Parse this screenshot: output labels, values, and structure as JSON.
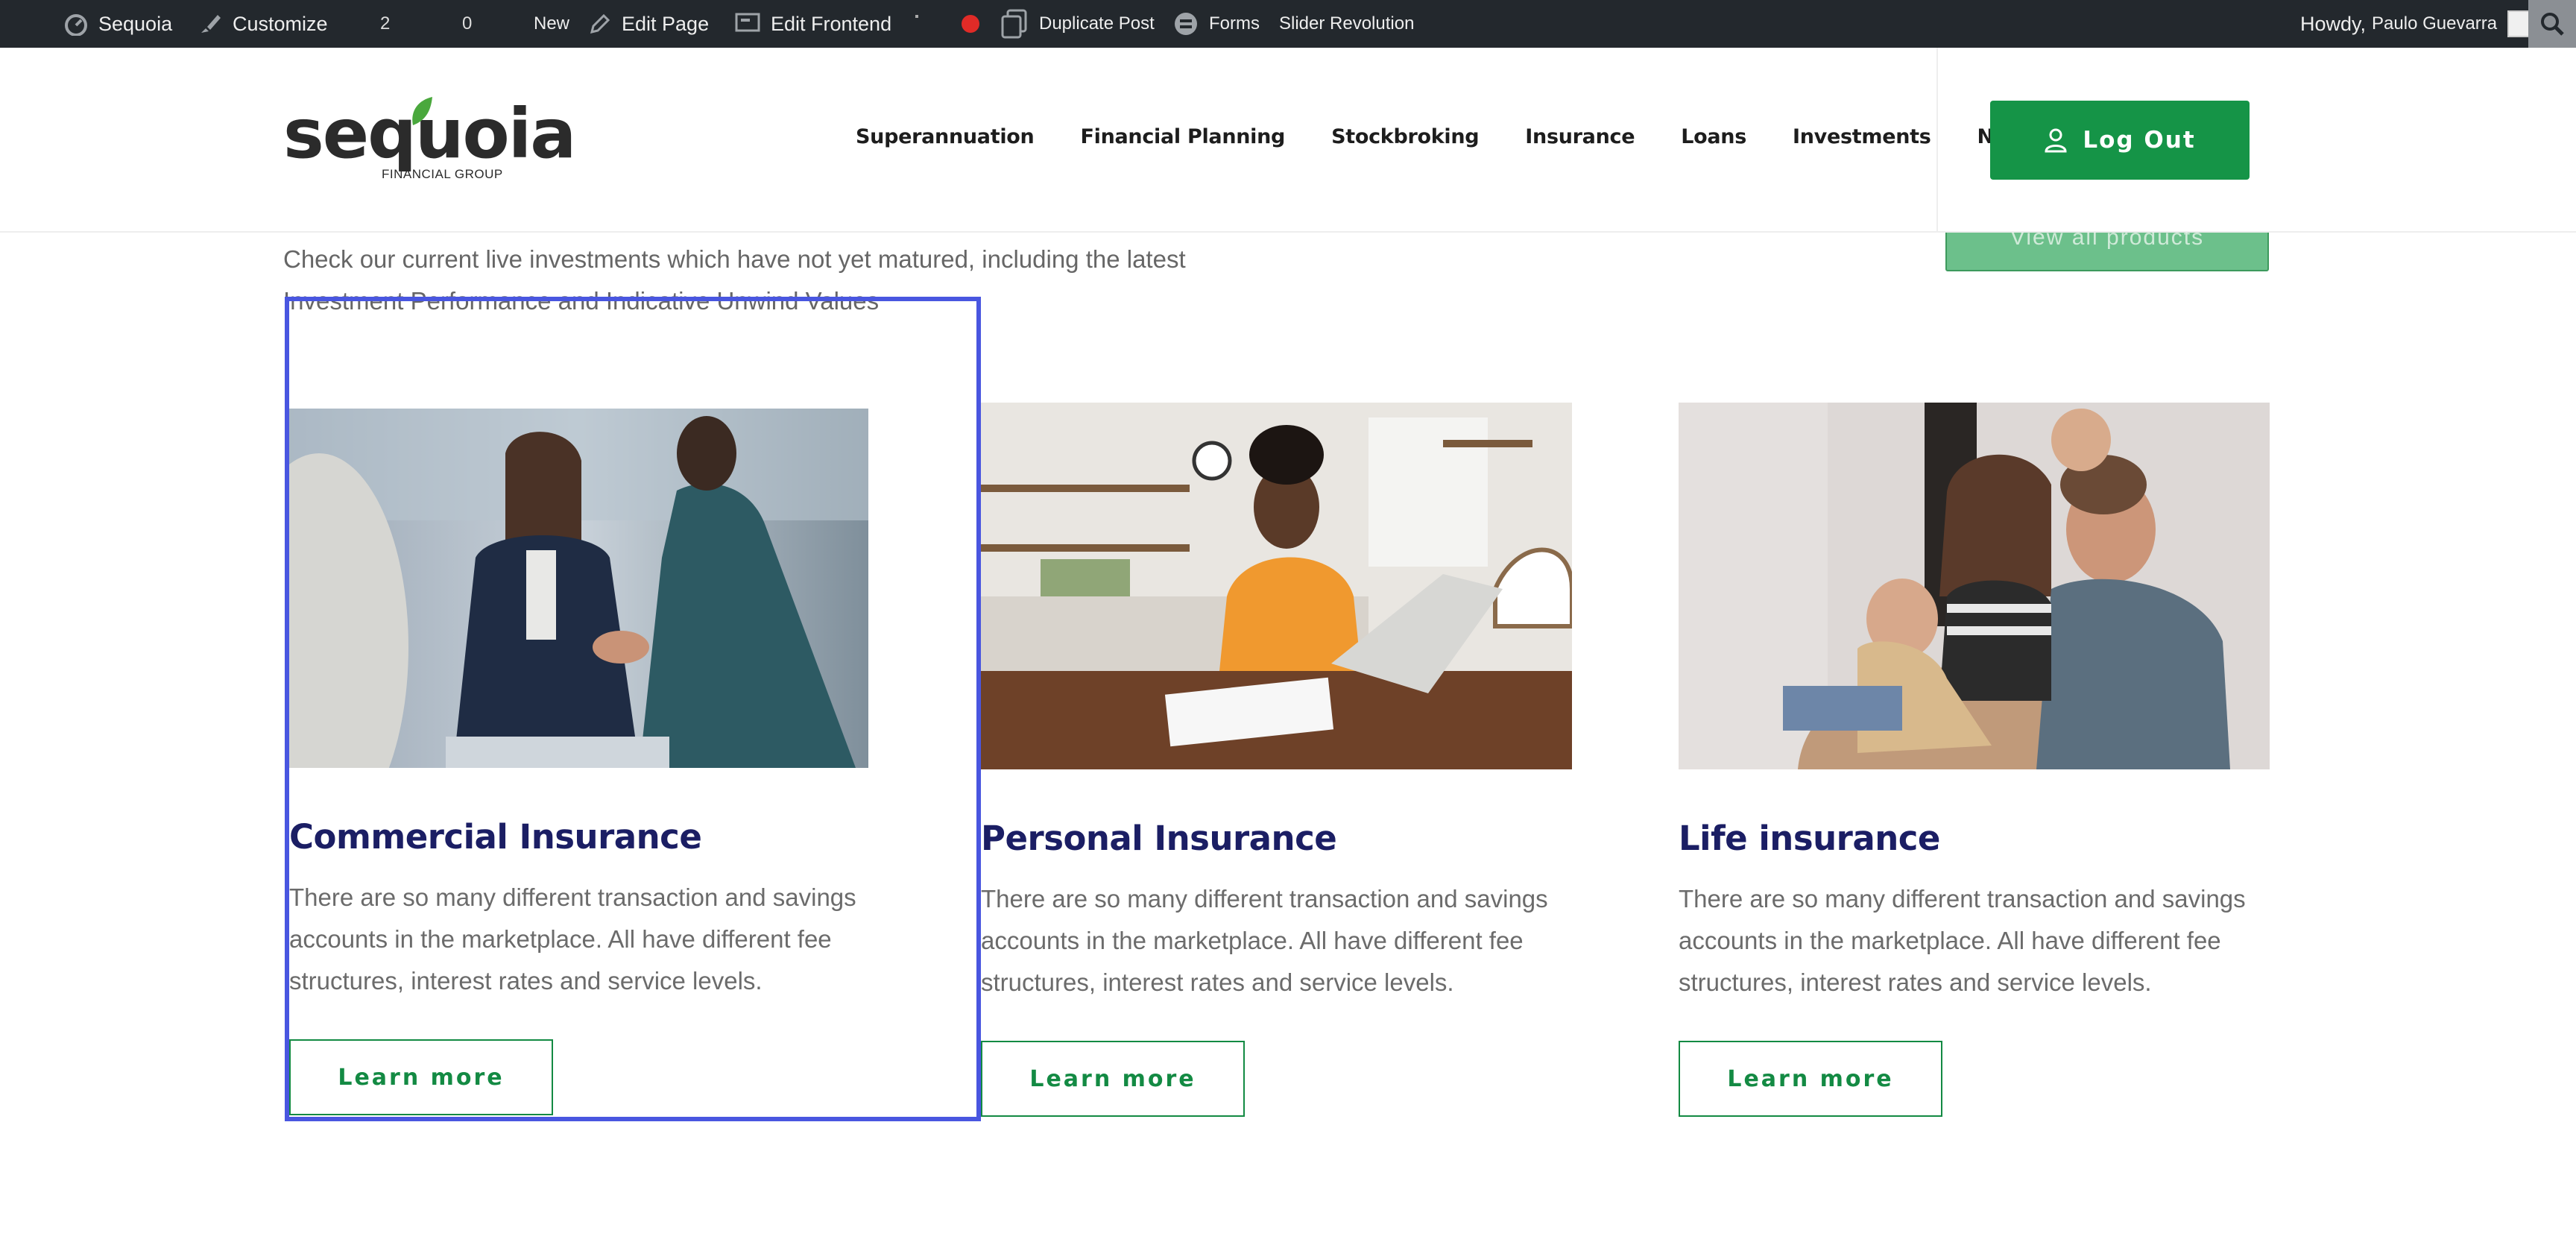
{
  "adminbar": {
    "site_name": "Sequoia",
    "customize": "Customize",
    "updates_count": "2",
    "comments_count": "0",
    "new": "New",
    "edit_page": "Edit Page",
    "edit_frontend": "Edit Frontend",
    "duplicate_post": "Duplicate Post",
    "forms": "Forms",
    "slider_revolution": "Slider Revolution",
    "howdy": "Howdy,",
    "user_name": "Paulo Guevarra"
  },
  "header": {
    "logo_word": "sequoia",
    "logo_sub": "FINANCIAL GROUP",
    "nav": [
      "Superannuation",
      "Financial Planning",
      "Stockbroking",
      "Insurance",
      "Loans",
      "Investments",
      "News"
    ],
    "logout_label": "Log Out"
  },
  "content": {
    "view_all": "View all products",
    "intro": "Check our current live investments which have not yet matured, including the latest Investment Performance and Indicative Unwind Values",
    "cards": [
      {
        "title": "Commercial Insurance",
        "text": "There are so many different transaction and savings accounts in the marketplace. All have different fee structures, interest rates and service levels.",
        "button": "Learn more"
      },
      {
        "title": "Personal Insurance",
        "text": "There are so many different transaction and savings accounts in the marketplace. All have different fee structures, interest rates and service levels.",
        "button": "Learn more"
      },
      {
        "title": "Life insurance",
        "text": "There are so many different transaction and savings accounts in the marketplace. All have different fee structures, interest rates and service levels.",
        "button": "Learn more"
      }
    ]
  },
  "colors": {
    "adminbar_bg": "#23282d",
    "brand_green": "#159447",
    "title_navy": "#1b1e64",
    "selection_blue": "#4956e0"
  }
}
